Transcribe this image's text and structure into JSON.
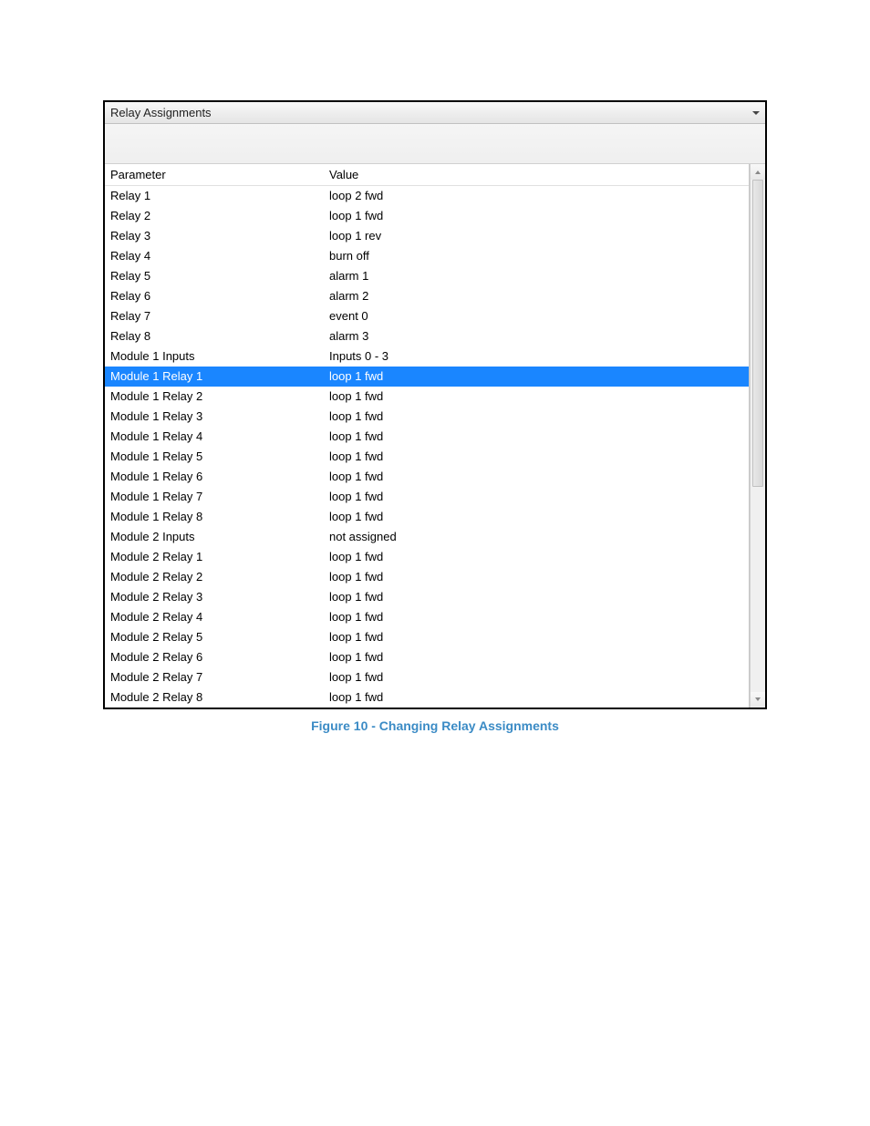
{
  "panel_title": "Relay Assignments",
  "columns": [
    "Parameter",
    "Value"
  ],
  "rows": [
    {
      "parameter": "Relay 1",
      "value": "loop 2 fwd",
      "selected": false
    },
    {
      "parameter": "Relay 2",
      "value": "loop 1 fwd",
      "selected": false
    },
    {
      "parameter": "Relay 3",
      "value": "loop 1 rev",
      "selected": false
    },
    {
      "parameter": "Relay 4",
      "value": "burn off",
      "selected": false
    },
    {
      "parameter": "Relay 5",
      "value": "alarm 1",
      "selected": false
    },
    {
      "parameter": "Relay 6",
      "value": "alarm 2",
      "selected": false
    },
    {
      "parameter": "Relay 7",
      "value": "event 0",
      "selected": false
    },
    {
      "parameter": "Relay 8",
      "value": "alarm 3",
      "selected": false
    },
    {
      "parameter": "Module 1 Inputs",
      "value": "Inputs 0 - 3",
      "selected": false
    },
    {
      "parameter": "Module 1 Relay 1",
      "value": "loop 1 fwd",
      "selected": true
    },
    {
      "parameter": "Module 1 Relay 2",
      "value": "loop 1 fwd",
      "selected": false
    },
    {
      "parameter": "Module 1 Relay 3",
      "value": "loop 1 fwd",
      "selected": false
    },
    {
      "parameter": "Module 1 Relay 4",
      "value": "loop 1 fwd",
      "selected": false
    },
    {
      "parameter": "Module 1 Relay 5",
      "value": "loop 1 fwd",
      "selected": false
    },
    {
      "parameter": "Module 1 Relay 6",
      "value": "loop 1 fwd",
      "selected": false
    },
    {
      "parameter": "Module 1 Relay 7",
      "value": "loop 1 fwd",
      "selected": false
    },
    {
      "parameter": "Module 1 Relay 8",
      "value": "loop 1 fwd",
      "selected": false
    },
    {
      "parameter": "Module 2 Inputs",
      "value": "not assigned",
      "selected": false
    },
    {
      "parameter": "Module 2 Relay 1",
      "value": "loop 1 fwd",
      "selected": false
    },
    {
      "parameter": "Module 2 Relay 2",
      "value": "loop 1 fwd",
      "selected": false
    },
    {
      "parameter": "Module 2 Relay 3",
      "value": "loop 1 fwd",
      "selected": false
    },
    {
      "parameter": "Module 2 Relay 4",
      "value": "loop 1 fwd",
      "selected": false
    },
    {
      "parameter": "Module 2 Relay 5",
      "value": "loop 1 fwd",
      "selected": false
    },
    {
      "parameter": "Module 2 Relay 6",
      "value": "loop 1 fwd",
      "selected": false
    },
    {
      "parameter": "Module 2 Relay 7",
      "value": "loop 1 fwd",
      "selected": false
    },
    {
      "parameter": "Module 2 Relay 8",
      "value": "loop 1 fwd",
      "selected": false
    }
  ],
  "caption": "Figure 10 - Changing Relay Assignments"
}
